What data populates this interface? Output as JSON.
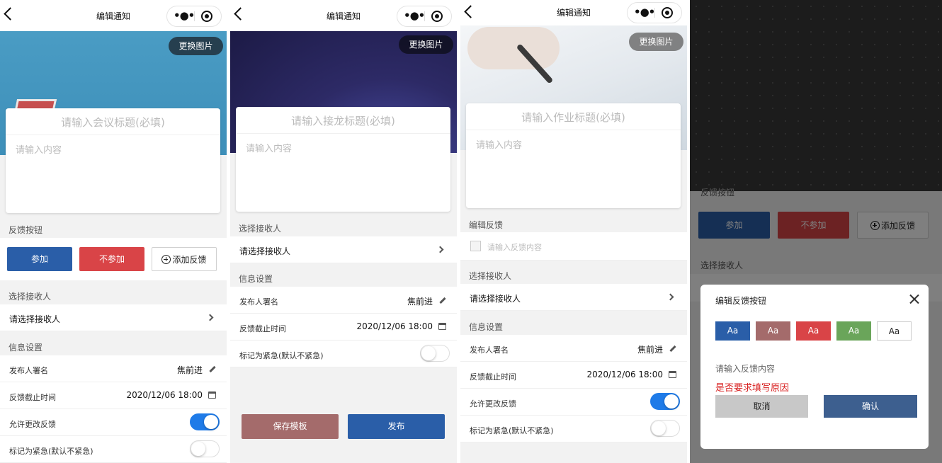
{
  "nav": {
    "title": "编辑通知"
  },
  "common": {
    "swap_image": "更换图片",
    "content_placeholder": "请输入内容",
    "select_receiver_section": "选择接收人",
    "select_receiver": "请选择接收人",
    "info_section": "信息设置",
    "publisher_label": "发布人署名",
    "publisher_value": "焦前进",
    "deadline_label": "反馈截止时间",
    "deadline_value": "2020/12/06 18:00",
    "allow_change_label": "允许更改反馈",
    "urgent_label": "标记为紧急(默认不紧急)"
  },
  "screen1": {
    "title_placeholder": "请输入会议标题(必填)",
    "feedback_section": "反馈按钮",
    "btn_join": "参加",
    "btn_not_join": "不参加",
    "btn_add_feedback": "添加反馈",
    "allow_change_on": true,
    "urgent_on": false
  },
  "screen2": {
    "title_placeholder": "请输入接龙标题(必填)",
    "save_template": "保存模板",
    "publish": "发布",
    "urgent_on": false
  },
  "screen3": {
    "title_placeholder": "请输入作业标题(必填)",
    "edit_feedback_section": "编辑反馈",
    "feedback_placeholder": "请输入反馈内容",
    "allow_change_on": true,
    "urgent_on": false
  },
  "screen4": {
    "cut_label": "反馈按钮",
    "btn_join": "参加",
    "btn_not_join": "不参加",
    "btn_add_feedback": "添加反馈",
    "select_receiver_section": "选择接收人",
    "modal_title": "编辑反馈按钮",
    "swatch_label": "Aa",
    "swatches": [
      "#2a5ea8",
      "#a46b6b",
      "#d94447",
      "#6aa55a",
      "#ffffff"
    ],
    "feedback_placeholder": "请输入反馈内容",
    "require_reason": "是否要求填写原因",
    "cancel": "取消",
    "confirm": "确认"
  },
  "colors": {
    "primary": "#2a5ea8",
    "danger": "#d94447",
    "template": "#a46b6b",
    "toggle_on": "#1f7be8",
    "warning_text": "#d81e1e"
  }
}
